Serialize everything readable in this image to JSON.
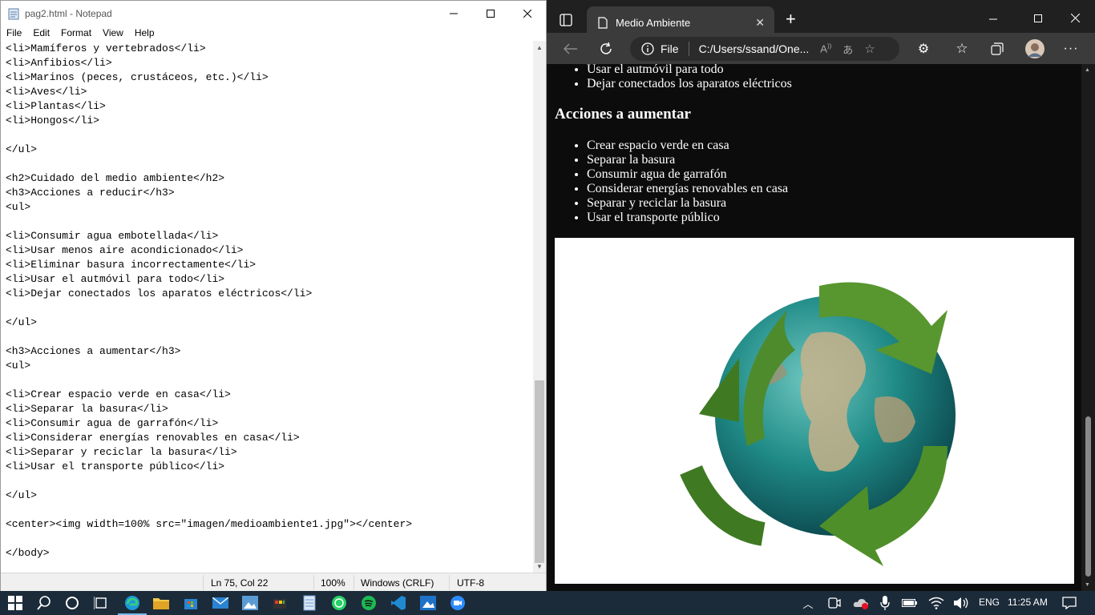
{
  "notepad": {
    "title": "pag2.html - Notepad",
    "menu": [
      "File",
      "Edit",
      "Format",
      "View",
      "Help"
    ],
    "content": "<li>Mamíferos y vertebrados</li>\n<li>Anfibios</li>\n<li>Marinos (peces, crustáceos, etc.)</li>\n<li>Aves</li>\n<li>Plantas</li>\n<li>Hongos</li>\n\n</ul>\n\n<h2>Cuidado del medio ambiente</h2>\n<h3>Acciones a reducir</h3>\n<ul>\n\n<li>Consumir agua embotellada</li>\n<li>Usar menos aire acondicionado</li>\n<li>Eliminar basura incorrectamente</li>\n<li>Usar el autmóvil para todo</li>\n<li>Dejar conectados los aparatos eléctricos</li>\n\n</ul>\n\n<h3>Acciones a aumentar</h3>\n<ul>\n\n<li>Crear espacio verde en casa</li>\n<li>Separar la basura</li>\n<li>Consumir agua de garrafón</li>\n<li>Considerar energías renovables en casa</li>\n<li>Separar y reciclar la basura</li>\n<li>Usar el transporte público</li>\n\n</ul>\n\n<center><img width=100% src=\"imagen/medioambiente1.jpg\"></center>\n\n</body>",
    "status": {
      "position": "Ln 75, Col 22",
      "zoom": "100%",
      "line_ending": "Windows (CRLF)",
      "encoding": "UTF-8"
    }
  },
  "edge": {
    "tab_title": "Medio Ambiente",
    "address_scheme": "File",
    "address_url": "C:/Users/ssand/One...",
    "page": {
      "top_items": [
        "Usar el autmóvil para todo",
        "Dejar conectados los aparatos eléctricos"
      ],
      "heading": "Acciones a aumentar",
      "items": [
        "Crear espacio verde en casa",
        "Separar la basura",
        "Consumir agua de garrafón",
        "Considerar energías renovables en casa",
        "Separar y reciclar la basura",
        "Usar el transporte público"
      ]
    }
  },
  "taskbar": {
    "language": "ENG",
    "time": "11:25 AM"
  },
  "colors": {
    "taskbar_bg": "#1c2b3a",
    "edge_chrome": "#3b3b3b",
    "page_bg": "#0c0c0c",
    "accent": "#76b9ed"
  }
}
